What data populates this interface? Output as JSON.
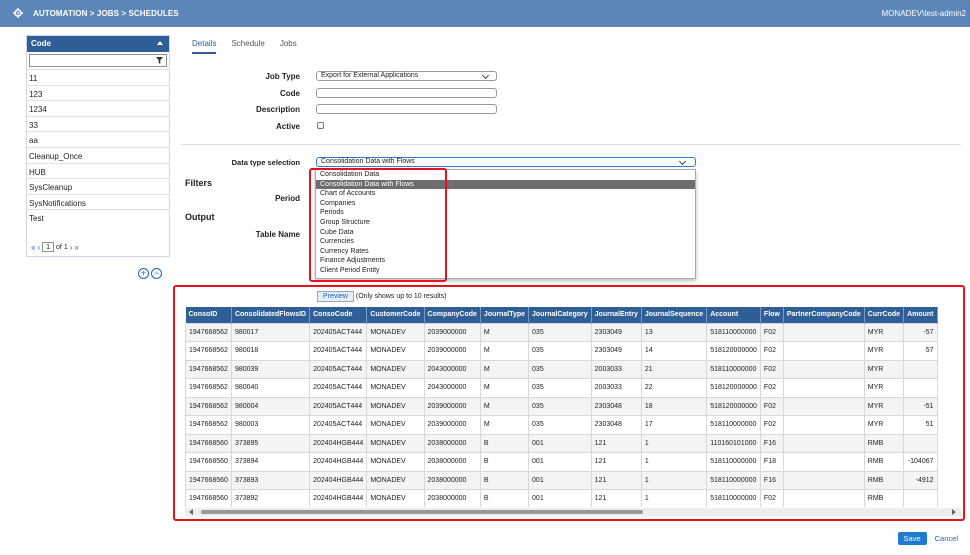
{
  "topbar": {
    "breadcrumb": "AUTOMATION > JOBS > SCHEDULES",
    "user": "MONADEV\\test-admin2",
    "icon": "gear-icon"
  },
  "left": {
    "header": "Code",
    "items": [
      "11",
      "123",
      "1234",
      "33",
      "aa",
      "Cleanup_Once",
      "HUB",
      "SysCleanup",
      "SysNotifications",
      "Test"
    ],
    "pager": {
      "page": "1",
      "of": "of 1"
    }
  },
  "tabs": [
    "Details",
    "Schedule",
    "Jobs"
  ],
  "form": {
    "job_type_label": "Job Type",
    "job_type_value": "Export for External Applications",
    "code_label": "Code",
    "description_label": "Description",
    "active_label": "Active",
    "data_type_label": "Data type selection",
    "data_type_value": "Consolidation Data with Flows",
    "filters_label": "Filters",
    "period_label": "Period",
    "output_label": "Output",
    "table_name_label": "Table Name"
  },
  "dropdown": {
    "options": [
      "Consolidation Data",
      "Consolidation Data with Flows",
      "Chart of Accounts",
      "Companies",
      "Periods",
      "Group Structure",
      "Cube Data",
      "Currencies",
      "Currency Rates",
      "Finance Adjustments",
      "Client Period Entity"
    ],
    "selected_index": 1
  },
  "preview": {
    "button": "Preview",
    "note": "(Only shows up to 10 results)"
  },
  "table": {
    "columns": [
      "ConsoID",
      "ConsolidatedFlowsID",
      "ConsoCode",
      "CustomerCode",
      "CompanyCode",
      "JournalType",
      "JournalCategory",
      "JournalEntry",
      "JournalSequence",
      "Account",
      "Flow",
      "PartnerCompanyCode",
      "CurrCode",
      "Amount"
    ],
    "rows": [
      [
        "1947668562",
        "980017",
        "202405ACT444",
        "MONADEV",
        "2039000000",
        "M",
        "035",
        "2303049",
        "13",
        "518110000000",
        "F02",
        "",
        "MYR",
        "-57"
      ],
      [
        "1947668562",
        "980018",
        "202405ACT444",
        "MONADEV",
        "2039000000",
        "M",
        "035",
        "2303049",
        "14",
        "518120000000",
        "F02",
        "",
        "MYR",
        "57"
      ],
      [
        "1947668562",
        "980039",
        "202405ACT444",
        "MONADEV",
        "2043000000",
        "M",
        "035",
        "2003033",
        "21",
        "518110000000",
        "F02",
        "",
        "MYR",
        ""
      ],
      [
        "1947668562",
        "980040",
        "202405ACT444",
        "MONADEV",
        "2043000000",
        "M",
        "035",
        "2003033",
        "22",
        "518120000000",
        "F02",
        "",
        "MYR",
        ""
      ],
      [
        "1947668562",
        "980004",
        "202405ACT444",
        "MONADEV",
        "2039000000",
        "M",
        "035",
        "2303048",
        "18",
        "518120000000",
        "F02",
        "",
        "MYR",
        "-51"
      ],
      [
        "1947668562",
        "980003",
        "202405ACT444",
        "MONADEV",
        "2039000000",
        "M",
        "035",
        "2303048",
        "17",
        "518110000000",
        "F02",
        "",
        "MYR",
        "51"
      ],
      [
        "1947668560",
        "373895",
        "202404HGB444",
        "MONADEV",
        "2038000000",
        "B",
        "001",
        "121",
        "1",
        "110160101000",
        "F16",
        "",
        "RMB",
        ""
      ],
      [
        "1947668560",
        "373894",
        "202404HGB444",
        "MONADEV",
        "2038000000",
        "B",
        "001",
        "121",
        "1",
        "518110000000",
        "F18",
        "",
        "RMB",
        "-104067"
      ],
      [
        "1947668560",
        "373893",
        "202404HGB444",
        "MONADEV",
        "2038000000",
        "B",
        "001",
        "121",
        "1",
        "518110000000",
        "F16",
        "",
        "RMB",
        "-4912"
      ],
      [
        "1947668560",
        "373892",
        "202404HGB444",
        "MONADEV",
        "2038000000",
        "B",
        "001",
        "121",
        "1",
        "518110000000",
        "F02",
        "",
        "RMB",
        ""
      ]
    ]
  },
  "footer": {
    "save": "Save",
    "cancel": "Cancel"
  },
  "colors": {
    "header": "#5b86b7",
    "table_header": "#2f5f96",
    "highlight": "#e5131b"
  }
}
